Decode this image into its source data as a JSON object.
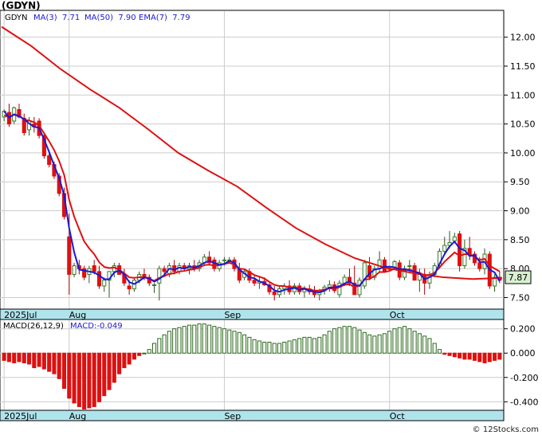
{
  "title": "(GDYN)",
  "credit": "© 12Stocks.com",
  "colors": {
    "up": "#3a7a2a",
    "down": "#dd1111",
    "ma_short": "#1a1ad6",
    "ma_long": "#dd1111",
    "macd_pos": "#2a6a1a",
    "macd_neg": "#dd1111",
    "axis_band": "#b0e4ec",
    "price_tag_bg": "#d8f0d0"
  },
  "legend": {
    "ticker": "GDYN",
    "ma3": "MA(3)  7.71",
    "ma50": "MA(50)  7.90",
    "ema7": "EMA(7)  7.79",
    "macd_params": "MACD(26,12,9)",
    "macd_value": "MACD:-0.049"
  },
  "price_tag": "7.87",
  "chart_data": [
    {
      "type": "candlestick",
      "title": "(GDYN)",
      "y_ticks": [
        "12.00",
        "11.50",
        "11.00",
        "10.50",
        "10.00",
        "9.50",
        "9.00",
        "8.50",
        "8.00",
        "7.50"
      ],
      "y_tick_values": [
        12.0,
        11.5,
        11.0,
        10.5,
        10.0,
        9.5,
        9.0,
        8.5,
        8.0,
        7.5
      ],
      "ylim": [
        7.3,
        12.45
      ],
      "x_labels": [
        {
          "label": "2025Jul",
          "index": 0
        },
        {
          "label": "Aug",
          "index": 13
        },
        {
          "label": "Sep",
          "index": 44
        },
        {
          "label": "Oct",
          "index": 77
        }
      ],
      "n_bars": 100,
      "candles": [
        [
          10.62,
          10.75,
          10.55,
          10.72
        ],
        [
          10.7,
          10.85,
          10.45,
          10.5
        ],
        [
          10.55,
          10.8,
          10.5,
          10.78
        ],
        [
          10.75,
          10.85,
          10.6,
          10.62
        ],
        [
          10.6,
          10.68,
          10.3,
          10.35
        ],
        [
          10.4,
          10.62,
          10.3,
          10.55
        ],
        [
          10.5,
          10.62,
          10.35,
          10.45
        ],
        [
          10.55,
          10.6,
          10.25,
          10.3
        ],
        [
          10.3,
          10.35,
          9.9,
          9.95
        ],
        [
          9.95,
          10.05,
          9.75,
          9.8
        ],
        [
          9.8,
          9.85,
          9.55,
          9.6
        ],
        [
          9.6,
          9.65,
          9.25,
          9.3
        ],
        [
          9.3,
          9.4,
          8.85,
          8.9
        ],
        [
          8.55,
          8.95,
          7.55,
          7.9
        ],
        [
          7.9,
          8.1,
          7.85,
          8.05
        ],
        [
          8.05,
          8.15,
          7.9,
          8.0
        ],
        [
          8.0,
          8.05,
          7.8,
          7.85
        ],
        [
          7.9,
          8.05,
          7.75,
          8.0
        ],
        [
          8.05,
          8.15,
          7.9,
          7.95
        ],
        [
          7.95,
          8.05,
          7.65,
          7.7
        ],
        [
          7.7,
          7.85,
          7.6,
          7.8
        ],
        [
          7.8,
          7.95,
          7.5,
          7.95
        ],
        [
          7.95,
          8.1,
          7.85,
          8.05
        ],
        [
          8.05,
          8.1,
          7.9,
          7.9
        ],
        [
          7.9,
          8.0,
          7.7,
          7.75
        ],
        [
          7.7,
          7.8,
          7.55,
          7.65
        ],
        [
          7.65,
          7.85,
          7.6,
          7.8
        ],
        [
          7.8,
          7.95,
          7.75,
          7.9
        ],
        [
          7.9,
          8.0,
          7.8,
          7.85
        ],
        [
          7.85,
          7.9,
          7.7,
          7.75
        ],
        [
          7.72,
          7.75,
          7.58,
          7.72
        ],
        [
          7.75,
          8.05,
          7.45,
          8.0
        ],
        [
          8.0,
          8.05,
          7.9,
          7.95
        ],
        [
          7.9,
          8.1,
          7.85,
          8.05
        ],
        [
          8.05,
          8.15,
          7.9,
          7.95
        ],
        [
          7.95,
          8.1,
          7.9,
          8.05
        ],
        [
          8.05,
          8.1,
          7.95,
          8.0
        ],
        [
          8.0,
          8.1,
          7.9,
          8.05
        ],
        [
          8.05,
          8.15,
          7.95,
          8.0
        ],
        [
          8.0,
          8.15,
          7.95,
          8.1
        ],
        [
          8.1,
          8.25,
          8.05,
          8.2
        ],
        [
          8.2,
          8.3,
          8.05,
          8.1
        ],
        [
          8.15,
          8.2,
          7.95,
          8.0
        ],
        [
          8.0,
          8.15,
          7.95,
          8.1
        ],
        [
          8.15,
          8.2,
          8.05,
          8.15
        ],
        [
          8.15,
          8.2,
          8.1,
          8.15
        ],
        [
          8.15,
          8.2,
          7.95,
          8.0
        ],
        [
          8.0,
          8.1,
          7.75,
          7.8
        ],
        [
          7.85,
          8.0,
          7.8,
          7.95
        ],
        [
          7.95,
          8.0,
          7.75,
          7.8
        ],
        [
          7.8,
          7.9,
          7.7,
          7.75
        ],
        [
          7.75,
          7.85,
          7.65,
          7.78
        ],
        [
          7.78,
          7.85,
          7.7,
          7.72
        ],
        [
          7.72,
          7.75,
          7.55,
          7.6
        ],
        [
          7.6,
          7.7,
          7.45,
          7.55
        ],
        [
          7.55,
          7.7,
          7.5,
          7.65
        ],
        [
          7.65,
          7.75,
          7.55,
          7.7
        ],
        [
          7.7,
          7.8,
          7.55,
          7.6
        ],
        [
          7.6,
          7.75,
          7.55,
          7.7
        ],
        [
          7.7,
          7.75,
          7.55,
          7.6
        ],
        [
          7.6,
          7.7,
          7.5,
          7.65
        ],
        [
          7.65,
          7.72,
          7.55,
          7.6
        ],
        [
          7.6,
          7.7,
          7.5,
          7.55
        ],
        [
          7.55,
          7.65,
          7.45,
          7.62
        ],
        [
          7.62,
          7.72,
          7.55,
          7.68
        ],
        [
          7.68,
          7.8,
          7.6,
          7.72
        ],
        [
          7.72,
          7.78,
          7.58,
          7.62
        ],
        [
          7.55,
          7.8,
          7.5,
          7.75
        ],
        [
          7.75,
          7.9,
          7.7,
          7.85
        ],
        [
          7.85,
          8.0,
          7.7,
          7.75
        ],
        [
          7.75,
          8.05,
          7.55,
          7.55
        ],
        [
          7.55,
          7.85,
          7.5,
          7.8
        ],
        [
          7.7,
          8.15,
          7.65,
          8.1
        ],
        [
          8.05,
          8.2,
          7.8,
          7.85
        ],
        [
          7.85,
          8.05,
          7.8,
          8.0
        ],
        [
          8.0,
          8.3,
          7.95,
          8.15
        ],
        [
          8.15,
          8.2,
          7.95,
          7.95
        ],
        [
          8.0,
          8.05,
          7.95,
          8.0
        ],
        [
          8.02,
          8.15,
          7.98,
          8.12
        ],
        [
          8.1,
          8.15,
          7.8,
          7.85
        ],
        [
          7.85,
          8.05,
          7.8,
          8.0
        ],
        [
          8.05,
          8.15,
          7.95,
          8.05
        ],
        [
          8.05,
          8.1,
          7.8,
          7.8
        ],
        [
          7.8,
          8.0,
          7.6,
          7.9
        ],
        [
          7.9,
          8.0,
          7.55,
          7.75
        ],
        [
          7.75,
          7.95,
          7.65,
          7.9
        ],
        [
          7.9,
          8.1,
          7.85,
          8.05
        ],
        [
          8.05,
          8.35,
          8.0,
          8.3
        ],
        [
          8.3,
          8.55,
          8.25,
          8.4
        ],
        [
          8.4,
          8.65,
          8.35,
          8.45
        ],
        [
          8.48,
          8.62,
          8.45,
          8.55
        ],
        [
          8.6,
          8.65,
          7.95,
          8.05
        ],
        [
          8.05,
          8.5,
          8.0,
          8.35
        ],
        [
          8.35,
          8.55,
          8.15,
          8.25
        ],
        [
          8.25,
          8.3,
          8.05,
          8.1
        ],
        [
          8.1,
          8.2,
          7.95,
          8.0
        ],
        [
          8.0,
          8.35,
          7.9,
          8.25
        ],
        [
          8.25,
          8.3,
          7.65,
          7.7
        ],
        [
          7.7,
          7.9,
          7.6,
          7.85
        ],
        [
          7.85,
          7.95,
          7.75,
          7.8
        ]
      ],
      "ema7": [
        10.65,
        10.62,
        10.66,
        10.65,
        10.57,
        10.56,
        10.53,
        10.47,
        10.34,
        10.2,
        10.05,
        9.86,
        9.62,
        9.19,
        8.9,
        8.68,
        8.47,
        8.35,
        8.25,
        8.11,
        8.03,
        8.01,
        8.02,
        7.98,
        7.92,
        7.85,
        7.84,
        7.85,
        7.85,
        7.82,
        7.79,
        7.84,
        7.87,
        7.91,
        7.92,
        7.95,
        7.96,
        7.98,
        7.99,
        8.02,
        8.06,
        8.07,
        8.05,
        8.06,
        8.08,
        8.1,
        8.07,
        8.0,
        7.99,
        7.94,
        7.89,
        7.86,
        7.83,
        7.77,
        7.72,
        7.7,
        7.7,
        7.67,
        7.68,
        7.66,
        7.66,
        7.64,
        7.62,
        7.62,
        7.64,
        7.66,
        7.65,
        7.68,
        7.72,
        7.73,
        7.68,
        7.71,
        7.81,
        7.82,
        7.87,
        7.94,
        7.94,
        7.96,
        8.0,
        7.96,
        7.97,
        7.99,
        7.94,
        7.93,
        7.88,
        7.89,
        7.93,
        8.02,
        8.12,
        8.2,
        8.28,
        8.22,
        8.25,
        8.25,
        8.2,
        8.15,
        8.17,
        8.05,
        8.0,
        7.95
      ],
      "ma50_curve": [
        [
          0,
          12.18
        ],
        [
          10,
          11.85
        ],
        [
          20,
          11.45
        ],
        [
          30,
          11.1
        ],
        [
          40,
          10.78
        ],
        [
          50,
          10.4
        ],
        [
          60,
          10.0
        ],
        [
          70,
          9.7
        ],
        [
          80,
          9.42
        ],
        [
          90,
          9.05
        ],
        [
          100,
          8.7
        ],
        [
          110,
          8.42
        ],
        [
          120,
          8.18
        ],
        [
          130,
          8.02
        ],
        [
          140,
          7.92
        ],
        [
          150,
          7.85
        ],
        [
          160,
          7.82
        ],
        [
          170,
          7.84
        ]
      ],
      "ma_note": "ma50_curve uses a 0-170 domain scaled to full width"
    },
    {
      "type": "bar",
      "title": "MACD(26,12,9)",
      "y_ticks": [
        "0.200",
        "0.000",
        "-0.200",
        "-0.400"
      ],
      "y_tick_values": [
        0.2,
        0.0,
        -0.2,
        -0.4
      ],
      "ylim": [
        -0.47,
        0.27
      ],
      "values": [
        -0.06,
        -0.07,
        -0.08,
        -0.07,
        -0.08,
        -0.09,
        -0.12,
        -0.11,
        -0.13,
        -0.15,
        -0.17,
        -0.21,
        -0.29,
        -0.37,
        -0.41,
        -0.44,
        -0.46,
        -0.45,
        -0.44,
        -0.4,
        -0.35,
        -0.3,
        -0.24,
        -0.17,
        -0.12,
        -0.09,
        -0.05,
        -0.02,
        0.0,
        0.03,
        0.08,
        0.12,
        0.15,
        0.18,
        0.2,
        0.21,
        0.22,
        0.23,
        0.23,
        0.24,
        0.24,
        0.23,
        0.22,
        0.21,
        0.2,
        0.19,
        0.18,
        0.17,
        0.15,
        0.13,
        0.11,
        0.1,
        0.09,
        0.09,
        0.08,
        0.08,
        0.09,
        0.1,
        0.11,
        0.12,
        0.13,
        0.13,
        0.12,
        0.13,
        0.15,
        0.18,
        0.2,
        0.21,
        0.22,
        0.22,
        0.21,
        0.19,
        0.17,
        0.15,
        0.14,
        0.15,
        0.16,
        0.18,
        0.2,
        0.21,
        0.22,
        0.2,
        0.18,
        0.16,
        0.14,
        0.12,
        0.08,
        0.03,
        -0.01,
        -0.02,
        -0.03,
        -0.04,
        -0.05,
        -0.05,
        -0.06,
        -0.07,
        -0.08,
        -0.07,
        -0.06,
        -0.05
      ],
      "x_labels": [
        {
          "label": "2025Jul",
          "index": 0
        },
        {
          "label": "Aug",
          "index": 13
        },
        {
          "label": "Sep",
          "index": 44
        },
        {
          "label": "Oct",
          "index": 77
        }
      ]
    }
  ]
}
